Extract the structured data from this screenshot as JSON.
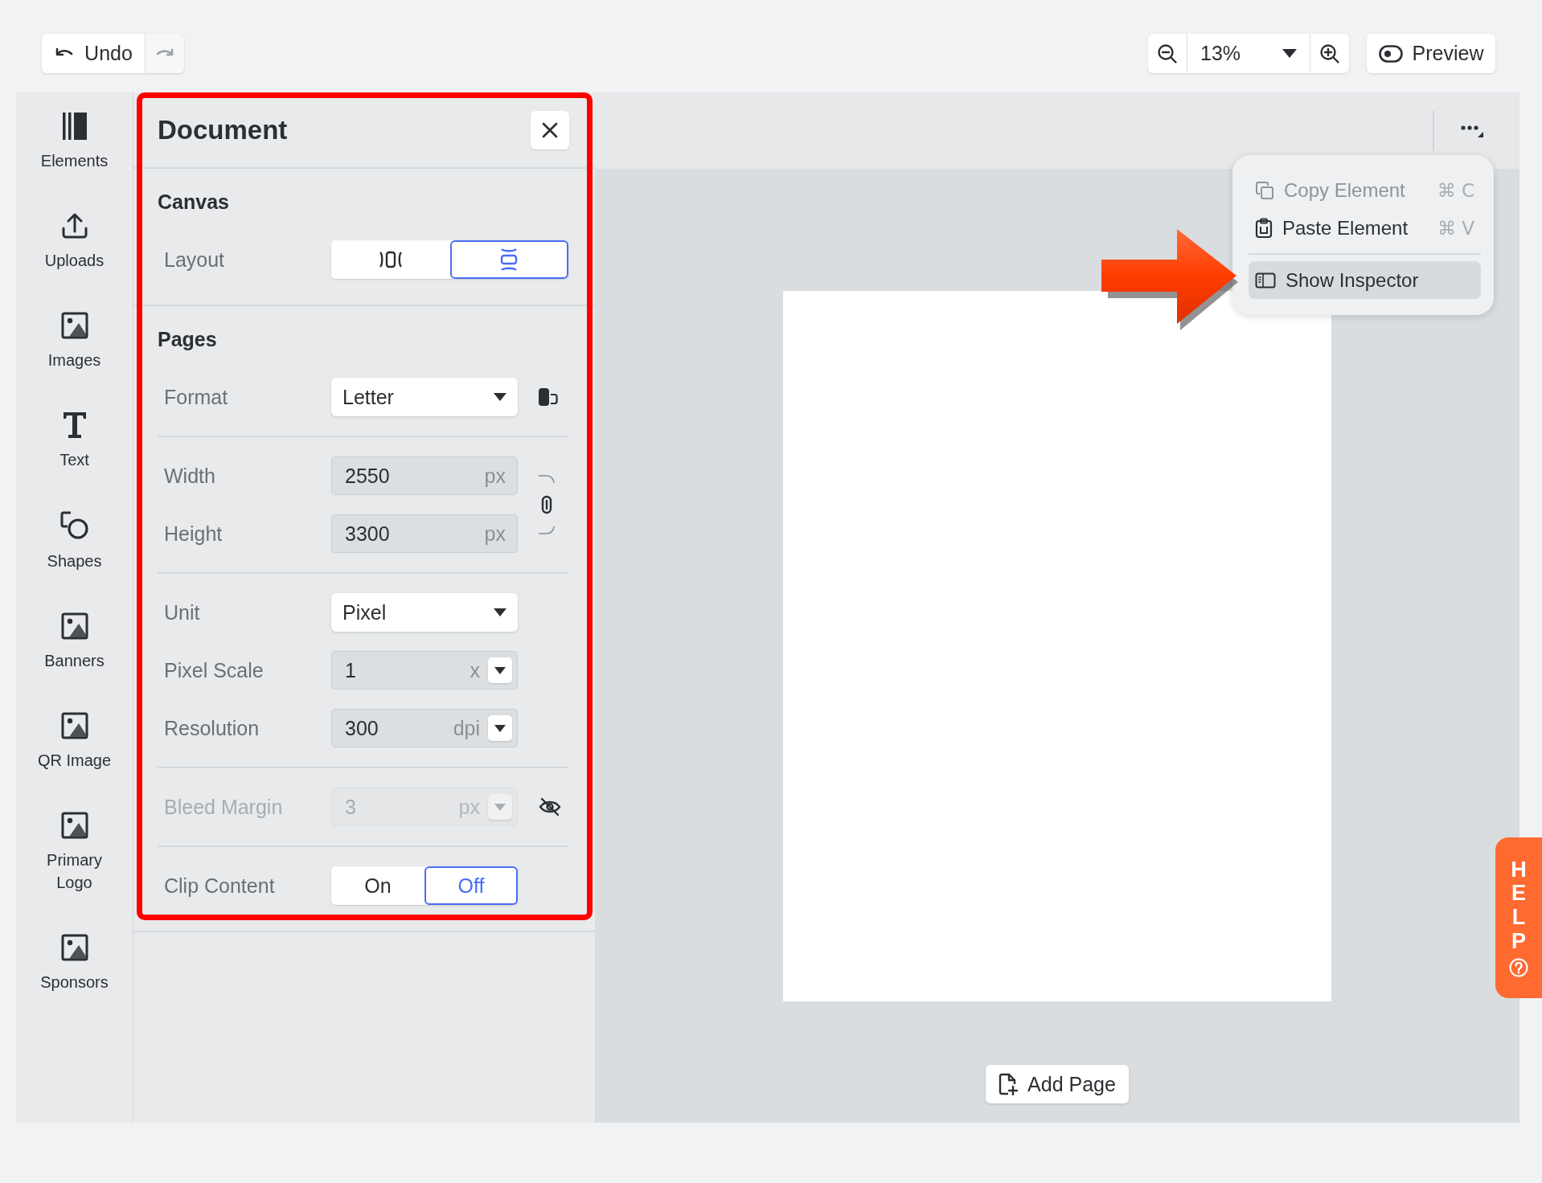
{
  "toolbar": {
    "undo": {
      "label": "Undo"
    },
    "redo": {
      "disabled": true
    },
    "zoom": {
      "value": "13%"
    },
    "preview": {
      "label": "Preview"
    }
  },
  "sidebar": {
    "items": [
      {
        "label": "Elements",
        "kind": "elements",
        "selected": false
      },
      {
        "label": "Uploads",
        "kind": "uploads",
        "selected": false
      },
      {
        "label": "Images",
        "kind": "image",
        "selected": false
      },
      {
        "label": "Text",
        "kind": "text",
        "selected": false
      },
      {
        "label": "Shapes",
        "kind": "shapes",
        "selected": false
      },
      {
        "label": "Banners",
        "kind": "image",
        "selected": false
      },
      {
        "label": "QR Image",
        "kind": "image",
        "selected": false
      },
      {
        "label": "Primary Logo",
        "kind": "image",
        "selected": false
      },
      {
        "label": "Sponsors",
        "kind": "image",
        "selected": false
      }
    ]
  },
  "panel": {
    "title": "Document",
    "sections": [
      {
        "title": "Canvas",
        "groups": [
          {
            "rows": [
              {
                "kind": "segmented",
                "label": "Layout",
                "options": [
                  {
                    "kind": "horizontal",
                    "selected": false
                  },
                  {
                    "kind": "vertical",
                    "selected": true
                  }
                ]
              }
            ]
          }
        ]
      },
      {
        "title": "Pages",
        "groups": [
          {
            "rows": [
              {
                "kind": "select",
                "label": "Format",
                "value": "Letter",
                "aside": {
                  "kind": "orientation"
                }
              }
            ]
          },
          {
            "linked": true,
            "rows": [
              {
                "kind": "number",
                "label": "Width",
                "value": "2550",
                "unit": "px",
                "disabled": false
              },
              {
                "kind": "number",
                "label": "Height",
                "value": "3300",
                "unit": "px",
                "disabled": false
              }
            ]
          },
          {
            "rows": [
              {
                "kind": "select",
                "label": "Unit",
                "value": "Pixel"
              },
              {
                "kind": "number",
                "label": "Pixel Scale",
                "value": "1",
                "unit": "x",
                "dropdown": true,
                "disabled": false
              },
              {
                "kind": "number",
                "label": "Resolution",
                "value": "300",
                "unit": "dpi",
                "dropdown": true,
                "disabled": false
              }
            ]
          },
          {
            "rows": [
              {
                "kind": "number",
                "label": "Bleed Margin",
                "value": "3",
                "unit": "px",
                "dropdown": true,
                "disabled": true,
                "aside": {
                  "kind": "hidden"
                }
              }
            ]
          },
          {
            "rows": [
              {
                "kind": "toggle",
                "label": "Clip Content",
                "options": [
                  {
                    "label": "On",
                    "selected": false
                  },
                  {
                    "label": "Off",
                    "selected": true
                  }
                ]
              }
            ]
          }
        ]
      }
    ]
  },
  "context_menu": {
    "groups": [
      [
        {
          "kind": "copy",
          "label": "Copy Element",
          "shortcut": "⌘ C",
          "disabled": true,
          "selected": false
        },
        {
          "kind": "paste",
          "label": "Paste Element",
          "shortcut": "⌘ V",
          "disabled": false,
          "selected": false
        }
      ],
      [
        {
          "kind": "inspector",
          "label": "Show Inspector",
          "disabled": false,
          "selected": true
        }
      ]
    ]
  },
  "canvas": {
    "add_page": {
      "label": "Add Page"
    }
  },
  "help_tab": {
    "label": "HELP"
  }
}
